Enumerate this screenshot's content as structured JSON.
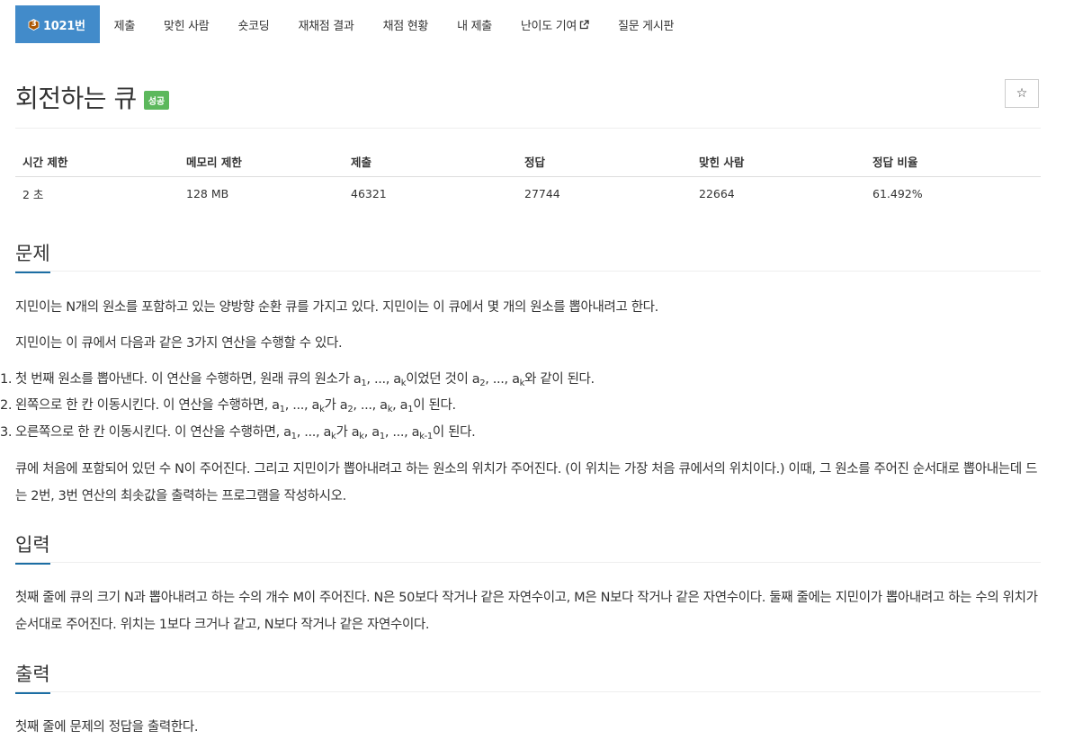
{
  "nav": {
    "tier_number": "3",
    "problem_tab": "1021번",
    "tabs": [
      "제출",
      "맞힌 사람",
      "숏코딩",
      "재채점 결과",
      "채점 현황",
      "내 제출",
      "난이도 기여",
      "질문 게시판"
    ]
  },
  "problem": {
    "title": "회전하는 큐",
    "status_badge": "성공",
    "star_label": "☆"
  },
  "info_table": {
    "headers": [
      "시간 제한",
      "메모리 제한",
      "제출",
      "정답",
      "맞힌 사람",
      "정답 비율"
    ],
    "values": [
      "2 초",
      "128 MB",
      "46321",
      "27744",
      "22664",
      "61.492%"
    ]
  },
  "sections": {
    "description": {
      "heading": "문제",
      "para1": "지민이는 N개의 원소를 포함하고 있는 양방향 순환 큐를 가지고 있다. 지민이는 이 큐에서 몇 개의 원소를 뽑아내려고 한다.",
      "para2": "지민이는 이 큐에서 다음과 같은 3가지 연산을 수행할 수 있다.",
      "ops": [
        {
          "num": "1.",
          "text": "첫 번째 원소를 뽑아낸다. 이 연산을 수행하면, 원래 큐의 원소가 a",
          "s1": "1",
          "t2": ", ..., a",
          "s2": "k",
          "t3": "이었던 것이 a",
          "s3": "2",
          "t4": ", ..., a",
          "s4": "k",
          "t5": "와 같이 된다.",
          "s5": "",
          "t6": ""
        },
        {
          "num": "2.",
          "text": "왼쪽으로 한 칸 이동시킨다. 이 연산을 수행하면, a",
          "s1": "1",
          "t2": ", ..., a",
          "s2": "k",
          "t3": "가 a",
          "s3": "2",
          "t4": ", ..., a",
          "s4": "k",
          "t5": ", a",
          "s5": "1",
          "t6": "이 된다."
        },
        {
          "num": "3.",
          "text": "오른쪽으로 한 칸 이동시킨다. 이 연산을 수행하면, a",
          "s1": "1",
          "t2": ", ..., a",
          "s2": "k",
          "t3": "가 a",
          "s3": "k",
          "t4": ", a",
          "s4": "1",
          "t5": ", ..., a",
          "s5": "k-1",
          "t6": "이 된다."
        }
      ],
      "para3": "큐에 처음에 포함되어 있던 수 N이 주어진다. 그리고 지민이가 뽑아내려고 하는 원소의 위치가 주어진다. (이 위치는 가장 처음 큐에서의 위치이다.) 이때, 그 원소를 주어진 순서대로 뽑아내는데 드는 2번, 3번 연산의 최솟값을 출력하는 프로그램을 작성하시오."
    },
    "input": {
      "heading": "입력",
      "text": "첫째 줄에 큐의 크기 N과 뽑아내려고 하는 수의 개수 M이 주어진다. N은 50보다 작거나 같은 자연수이고, M은 N보다 작거나 같은 자연수이다. 둘째 줄에는 지민이가 뽑아내려고 하는 수의 위치가 순서대로 주어진다. 위치는 1보다 크거나 같고, N보다 작거나 같은 자연수이다."
    },
    "output": {
      "heading": "출력",
      "text": "첫째 줄에 문제의 정답을 출력한다."
    }
  },
  "colors": {
    "active_tab": "#428bca",
    "badge_success": "#5cb85c",
    "section_underline": "#1c6ea4"
  }
}
